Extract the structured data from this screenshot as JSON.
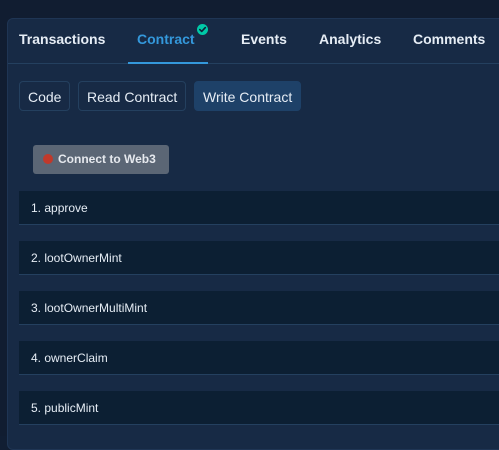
{
  "tabs": [
    {
      "label": "Transactions",
      "active": false
    },
    {
      "label": "Contract",
      "active": true,
      "verified": true
    },
    {
      "label": "Events",
      "active": false
    },
    {
      "label": "Analytics",
      "active": false
    },
    {
      "label": "Comments",
      "active": false
    }
  ],
  "subtabs": [
    {
      "label": "Code",
      "active": false
    },
    {
      "label": "Read Contract",
      "active": false
    },
    {
      "label": "Write Contract",
      "active": true
    }
  ],
  "connect_button": {
    "label": "Connect to Web3",
    "status_color": "#c0392b"
  },
  "functions": [
    {
      "label": "1. approve"
    },
    {
      "label": "2. lootOwnerMint"
    },
    {
      "label": "3. lootOwnerMultiMint"
    },
    {
      "label": "4. ownerClaim"
    },
    {
      "label": "5. publicMint"
    }
  ],
  "colors": {
    "accent": "#3498db",
    "verified": "#00c9a7",
    "card_bg": "#172a45",
    "row_bg": "#0c1f33",
    "active_subtab_bg": "#1e4168"
  },
  "icons": {
    "verified": "check-circle-icon",
    "connection_status": "status-dot-icon"
  }
}
